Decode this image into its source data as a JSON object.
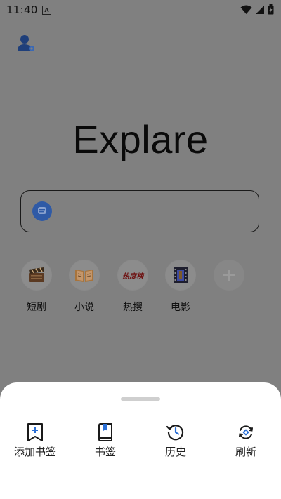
{
  "status_bar": {
    "time": "11:40",
    "notif_letter": "A"
  },
  "logo": "Explare",
  "shortcuts": [
    {
      "label": "短剧",
      "icon": "clapperboard-icon"
    },
    {
      "label": "小说",
      "icon": "book-icon"
    },
    {
      "label": "热搜",
      "icon": "hot-list-icon",
      "badge_text": "热度榜"
    },
    {
      "label": "电影",
      "icon": "film-icon"
    }
  ],
  "sheet": {
    "actions": [
      {
        "label": "添加书签",
        "icon": "add-bookmark-icon"
      },
      {
        "label": "书签",
        "icon": "bookmarks-icon"
      },
      {
        "label": "历史",
        "icon": "history-icon"
      },
      {
        "label": "刷新",
        "icon": "refresh-icon"
      }
    ]
  },
  "colors": {
    "accent": "#2f5aa6",
    "scrim": "#808080",
    "sheet": "#ffffff"
  }
}
